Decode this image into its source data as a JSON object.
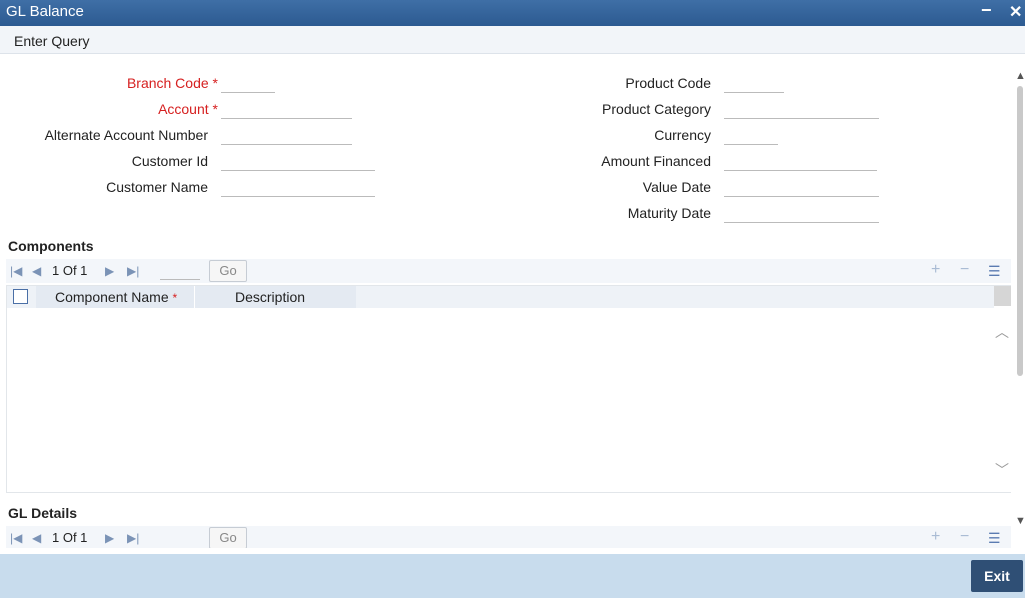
{
  "window": {
    "title": "GL Balance",
    "minimize_glyph": "−",
    "close_glyph": "✕"
  },
  "menu": {
    "enter_query": "Enter Query"
  },
  "form": {
    "left": [
      {
        "label": "Branch Code",
        "required": true
      },
      {
        "label": "Account",
        "required": true
      },
      {
        "label": "Alternate Account Number",
        "required": false
      },
      {
        "label": "Customer Id",
        "required": false
      },
      {
        "label": "Customer Name",
        "required": false
      }
    ],
    "right": [
      {
        "label": "Product Code"
      },
      {
        "label": "Product Category"
      },
      {
        "label": "Currency"
      },
      {
        "label": "Amount Financed"
      },
      {
        "label": "Value Date"
      },
      {
        "label": "Maturity Date"
      }
    ],
    "required_marker": "*"
  },
  "components": {
    "title": "Components",
    "pager": {
      "page_text": "1 Of 1",
      "go_label": "Go"
    },
    "columns": [
      {
        "label": "Component Name",
        "required": true
      },
      {
        "label": "Description",
        "required": false
      }
    ],
    "rows": []
  },
  "gl_details": {
    "title": "GL Details",
    "pager": {
      "page_text": "1 Of 1",
      "go_label": "Go"
    }
  },
  "footer": {
    "exit_label": "Exit"
  },
  "icons": {
    "first": "first-page-icon",
    "prev": "prev-page-icon",
    "next": "next-page-icon",
    "last": "last-page-icon",
    "add": "add-row-icon",
    "delete": "delete-row-icon",
    "view": "single-view-icon"
  },
  "colors": {
    "title_bar": "#2c5a91",
    "required": "#d62020",
    "footer": "#c8dced",
    "exit_button": "#2f4f75"
  }
}
